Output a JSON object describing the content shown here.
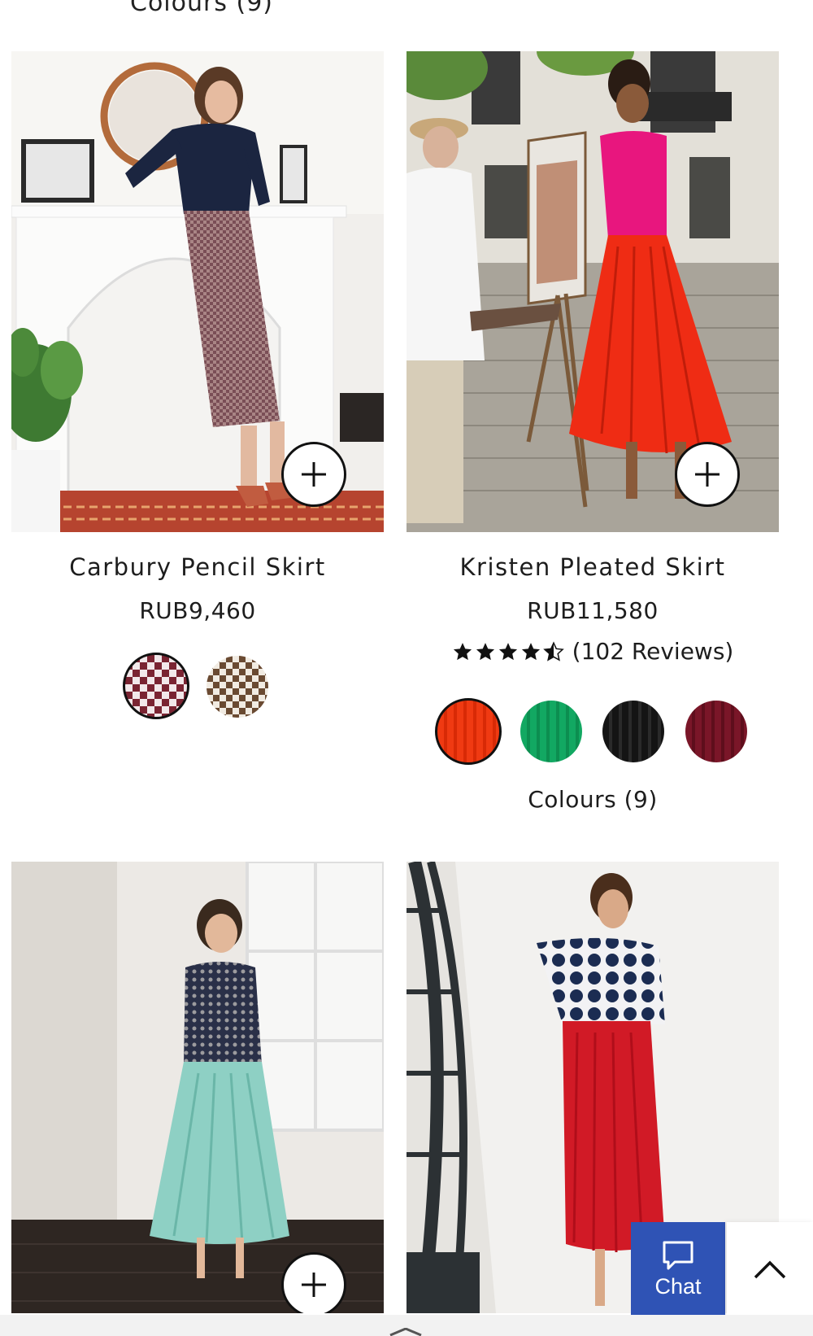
{
  "top_cut_text": "Colours (9)",
  "products": [
    {
      "name": "Carbury Pencil Skirt",
      "price": "RUB9,460",
      "add_icon": "plus-icon",
      "swatches": [
        {
          "label": "red houndstooth",
          "color": "#7a2432",
          "selected": true
        },
        {
          "label": "brown houndstooth",
          "color": "#8a6a4a",
          "selected": false
        }
      ]
    },
    {
      "name": "Kristen Pleated Skirt",
      "price": "RUB11,580",
      "rating": 4.5,
      "reviews": "(102 Reviews)",
      "add_icon": "plus-icon",
      "swatches": [
        {
          "label": "red",
          "color": "#f03a12",
          "selected": true
        },
        {
          "label": "green",
          "color": "#12a862",
          "selected": false
        },
        {
          "label": "black",
          "color": "#141414",
          "selected": false
        },
        {
          "label": "burgundy",
          "color": "#7a1628",
          "selected": false
        }
      ],
      "colours_link": "Colours (9)"
    },
    {
      "add_icon": "plus-icon"
    },
    {}
  ],
  "chat": {
    "label": "Chat",
    "icon": "chat-bubble-icon",
    "color": "#2f53b5"
  },
  "back_to_top": {
    "icon": "chevron-up-icon"
  }
}
